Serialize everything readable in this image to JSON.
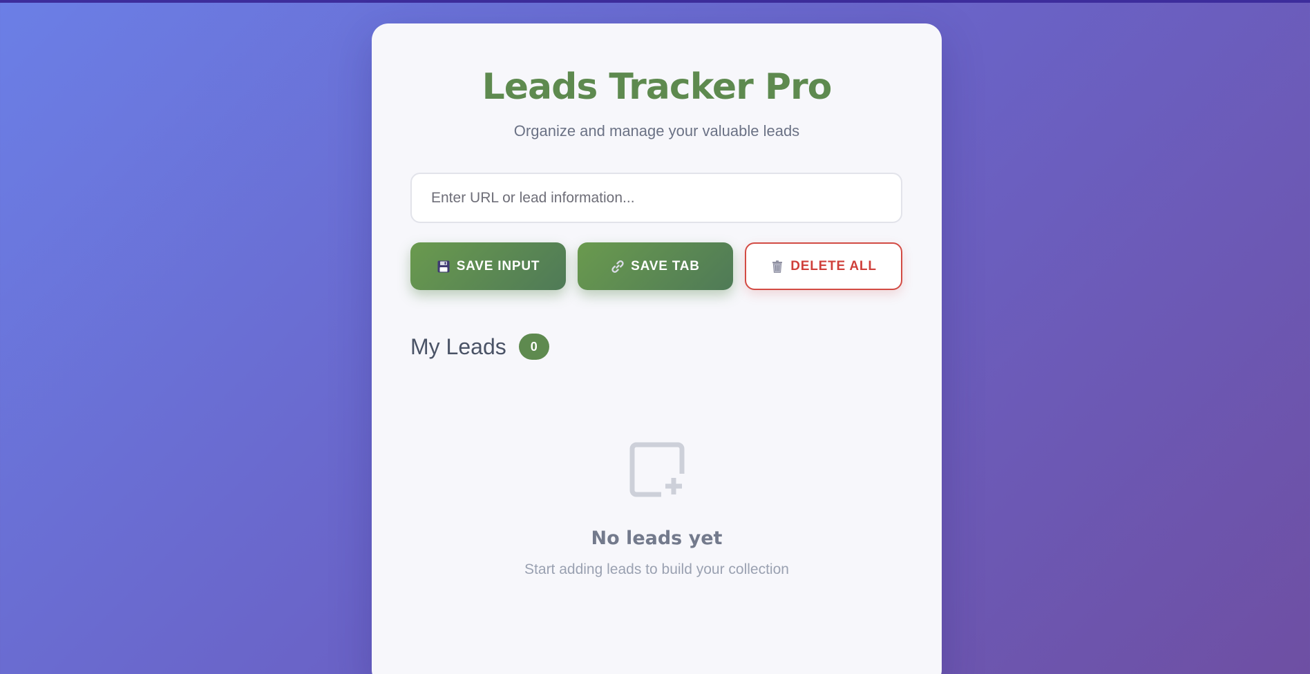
{
  "app": {
    "title": "Leads Tracker Pro",
    "subtitle": "Organize and manage your valuable leads"
  },
  "input": {
    "placeholder": "Enter URL or lead information...",
    "value": ""
  },
  "buttons": {
    "save_input": {
      "label": "SAVE INPUT",
      "icon": "floppy-disk-icon"
    },
    "save_tab": {
      "label": "SAVE TAB",
      "icon": "link-icon"
    },
    "delete_all": {
      "label": "DELETE ALL",
      "icon": "trash-icon"
    }
  },
  "leads": {
    "heading": "My Leads",
    "count": "0"
  },
  "empty_state": {
    "icon": "add-note-icon",
    "title": "No leads yet",
    "subtitle": "Start adding leads to build your collection"
  },
  "colors": {
    "brand_green": "#5e8a4f",
    "danger_red": "#cf3f3a",
    "background_gradient_start": "#6b7fe6",
    "background_gradient_end": "#6e4fa3"
  }
}
